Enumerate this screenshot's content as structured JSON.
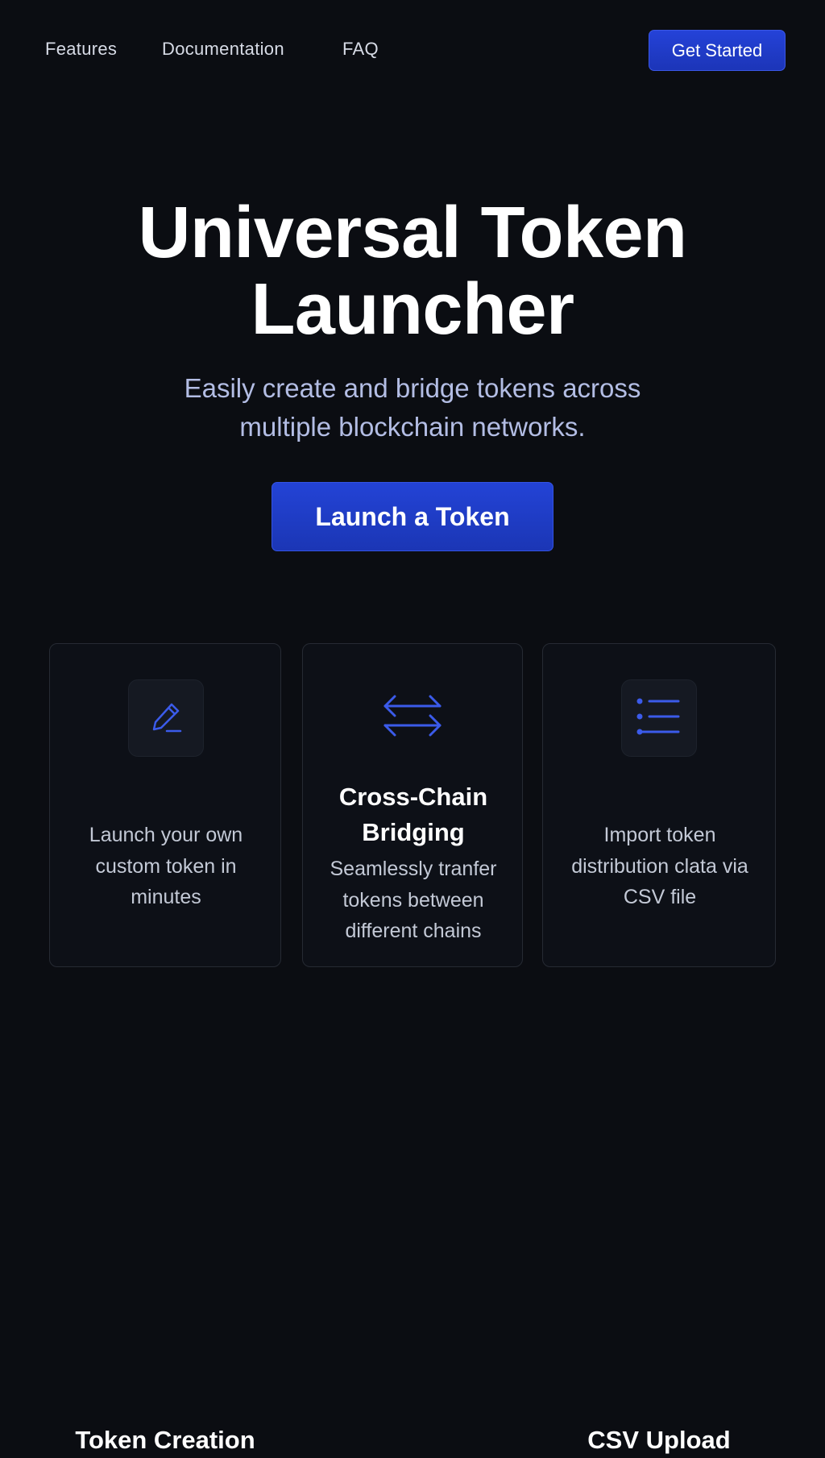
{
  "nav": {
    "links": [
      {
        "label": "Features"
      },
      {
        "label": "Documentation"
      },
      {
        "label": "FAQ"
      }
    ],
    "cta_label": "Get Started"
  },
  "hero": {
    "title": "Universal Token Launcher",
    "subtitle": "Easily create and bridge tokens across multiple blockchain networks.",
    "button_label": "Launch a Token"
  },
  "features": [
    {
      "icon": "pen-icon",
      "title": "Token Creation",
      "description": "Launch your own custom token in minutes"
    },
    {
      "icon": "arrows-exchange-icon",
      "title": "Cross-Chain Bridging",
      "description": "Seamlessly tranfer tokens between different chains"
    },
    {
      "icon": "list-icon",
      "title": "CSV Upload",
      "description": "Import token distribution clata via CSV file"
    }
  ],
  "colors": {
    "background": "#0b0d12",
    "accent": "#2442d8",
    "icon_accent": "#3b5bea",
    "subtitle": "#b3bde4"
  }
}
